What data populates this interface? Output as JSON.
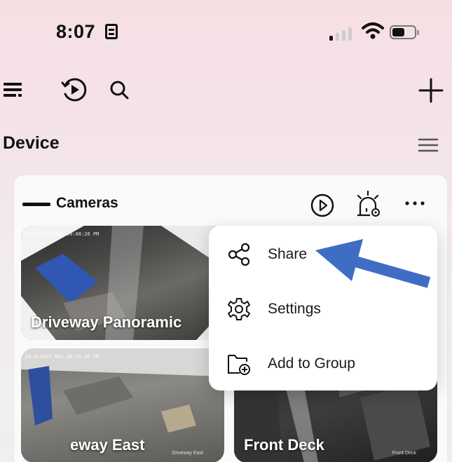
{
  "status_bar": {
    "time": "8:07",
    "icons": [
      "sim-card-icon",
      "signal-icon",
      "wifi-icon",
      "battery-icon"
    ],
    "battery_level": 0.55
  },
  "toolbar": {
    "left_icons": [
      "list-view-icon",
      "playback-icon",
      "search-icon"
    ],
    "right_icon": "add-icon"
  },
  "section": {
    "title": "Device",
    "menu_icon": "hamburger-icon"
  },
  "group": {
    "title": "Cameras",
    "actions": [
      "play-all-icon",
      "alarm-icon",
      "more-icon"
    ]
  },
  "cameras": [
    {
      "name": "Driveway Panoramic",
      "timestamp": "20-6-2025 Mon 09:08:26 PM"
    },
    {
      "name": "Driveway East",
      "timestamp": "20-6-2025 Mon 08:51:20 PM",
      "tag": "Driveway East"
    },
    {
      "name": "Front Deck",
      "tag": "Front Deck"
    }
  ],
  "popup_menu": {
    "items": [
      {
        "label": "Share",
        "icon": "share-icon"
      },
      {
        "label": "Settings",
        "icon": "gear-icon"
      },
      {
        "label": "Add to Group",
        "icon": "add-folder-icon"
      }
    ]
  },
  "colors": {
    "accent_arrow": "#3f6dc4",
    "background_top": "#f6dfe4",
    "card_background": "#fafafa"
  }
}
